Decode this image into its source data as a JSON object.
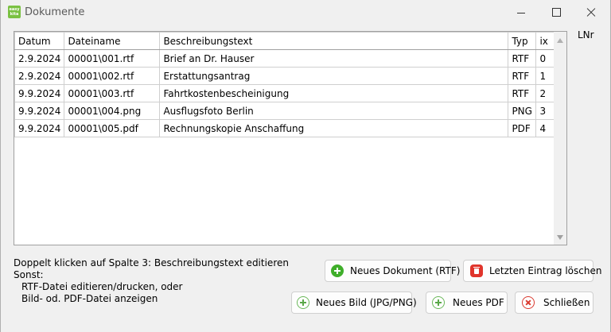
{
  "window": {
    "title": "Dokumente",
    "app_icon_text": [
      "easy",
      "kita"
    ]
  },
  "grid": {
    "columns": [
      "Datum",
      "Dateiname",
      "Beschreibungstext",
      "Typ",
      "ix"
    ],
    "rows": [
      [
        "2.9.2024",
        "00001\\001.rtf",
        "Brief an Dr. Hauser",
        "RTF",
        "0"
      ],
      [
        "2.9.2024",
        "00001\\002.rtf",
        "Erstattungsantrag",
        "RTF",
        "1"
      ],
      [
        "9.9.2024",
        "00001\\003.rtf",
        "Fahrtkostenbescheinigung",
        "RTF",
        "2"
      ],
      [
        "9.9.2024",
        "00001\\004.png",
        "Ausflugsfoto Berlin",
        "PNG",
        "3"
      ],
      [
        "9.9.2024",
        "00001\\005.pdf",
        "Rechnungskopie Anschaffung",
        "PDF",
        "4"
      ]
    ]
  },
  "side_label": "LNr",
  "help": {
    "line1": "Doppelt klicken auf Spalte 3: Beschreibungstext editieren",
    "line2": "Sonst:",
    "line3": "RTF-Datei editieren/drucken, oder",
    "line4": "Bild- od. PDF-Datei anzeigen"
  },
  "buttons": {
    "new_rtf": "Neues Dokument (RTF)",
    "delete_last": "Letzten Eintrag löschen",
    "new_image": "Neues Bild (JPG/PNG)",
    "new_pdf": "Neues PDF",
    "close": "Schließen"
  }
}
